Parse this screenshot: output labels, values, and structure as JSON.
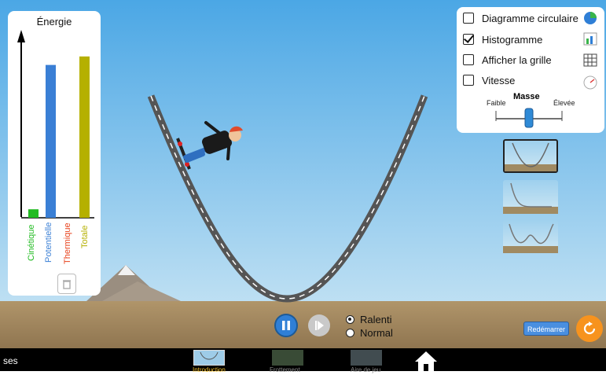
{
  "energy_panel": {
    "title": "Énergie",
    "bars": [
      {
        "label": "Cinétique",
        "color": "#22bb22",
        "value": 0.02
      },
      {
        "label": "Potentielle",
        "color": "#3a7fd5",
        "value": 0.36
      },
      {
        "label": "Thermique",
        "color": "#e8431d",
        "value": 0.0
      },
      {
        "label": "Totale",
        "color": "#b5b000",
        "value": 0.38
      }
    ]
  },
  "controls": {
    "checkboxes": [
      {
        "label": "Diagramme circulaire",
        "checked": false,
        "icon": "pie-chart-icon"
      },
      {
        "label": "Histogramme",
        "checked": true,
        "icon": "bar-chart-icon"
      },
      {
        "label": "Afficher la grille",
        "checked": false,
        "icon": "grid-icon"
      },
      {
        "label": "Vitesse",
        "checked": false,
        "icon": "speedometer-icon"
      }
    ],
    "mass": {
      "label": "Masse",
      "min_label": "Faible",
      "max_label": "Élevée",
      "value": 0.5
    }
  },
  "tracks": [
    "track-u-icon",
    "track-ramp-icon",
    "track-double-icon"
  ],
  "playback": {
    "speed_options": [
      "Ralenti",
      "Normal"
    ],
    "selected": "Ralenti"
  },
  "restart_label": "Redémarrer",
  "nav": {
    "left_fragment": "ses",
    "tabs": [
      "Introduction",
      "Frottement",
      "Aire de jeu"
    ]
  },
  "colors": {
    "sky": "#5aaee6",
    "ground": "#9f8458",
    "accent": "#f7931e"
  }
}
